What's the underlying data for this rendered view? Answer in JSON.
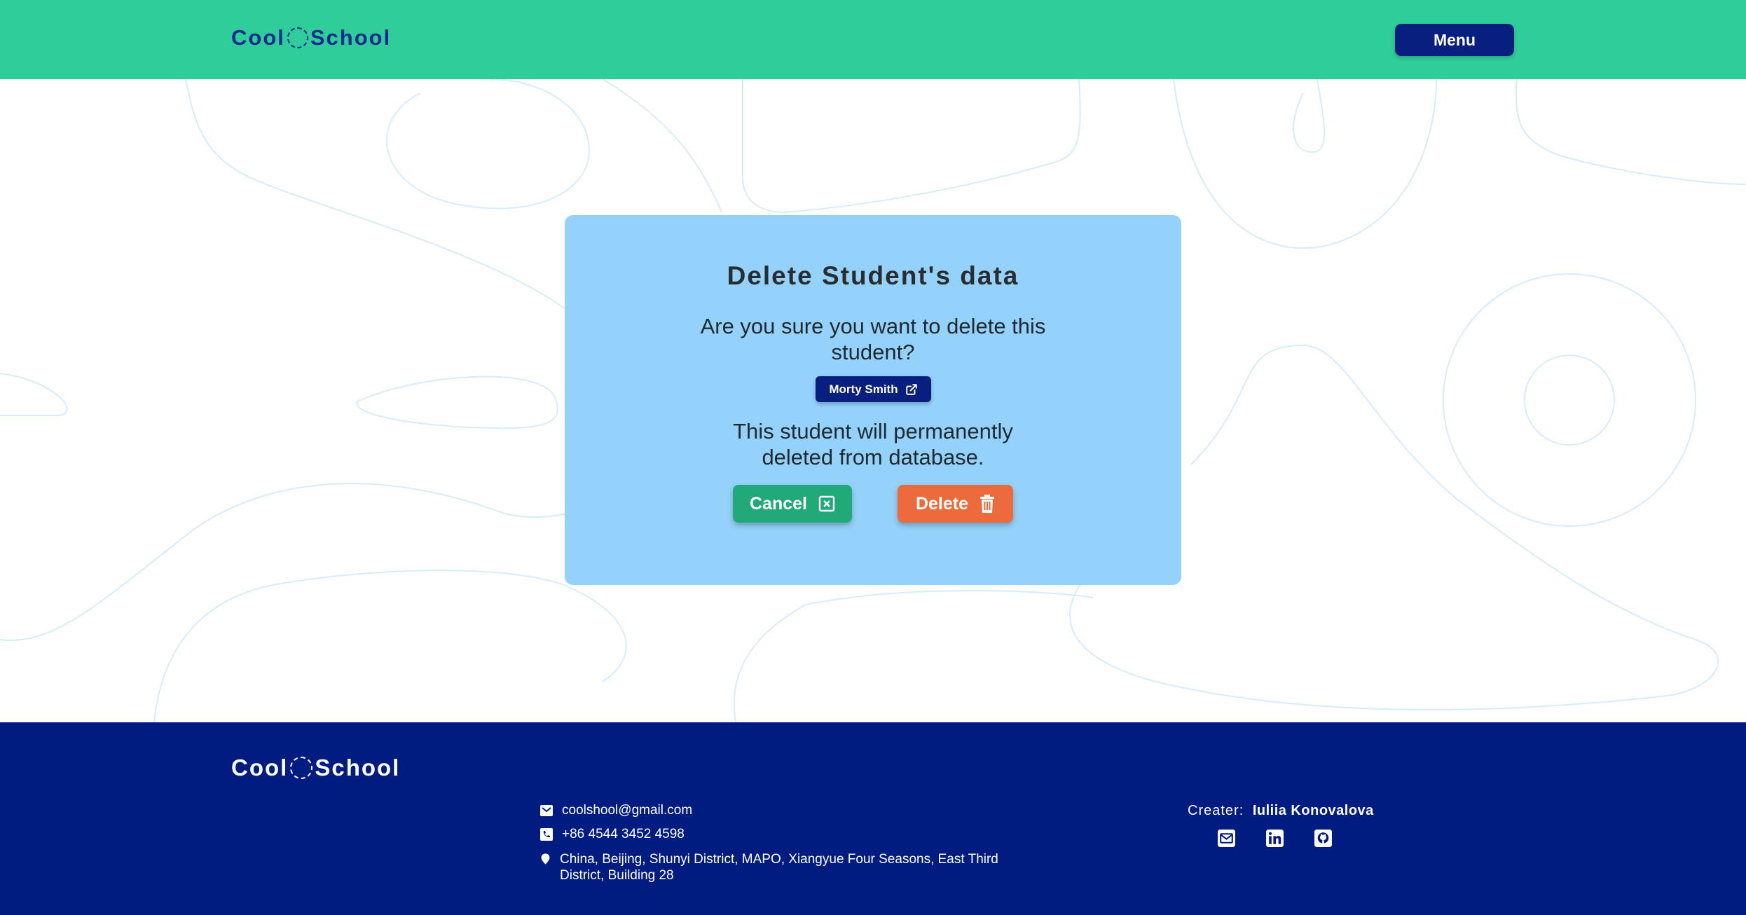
{
  "header": {
    "logo_left": "Cool",
    "logo_right": "School",
    "menu_label": "Menu"
  },
  "modal": {
    "title": "Delete Student's data",
    "question": "Are you sure you want to delete this student?",
    "student_name": "Morty Smith",
    "warning": "This student will permanently deleted from database.",
    "cancel_label": "Cancel",
    "delete_label": "Delete"
  },
  "footer": {
    "logo_left": "Cool",
    "logo_right": "School",
    "email": "coolshool@gmail.com",
    "phone": "+86 4544 3452 4598",
    "address": "China, Beijing, Shunyi District, MAPO, Xiangyue Four Seasons, East Third District, Building 28",
    "creator_label": "Creater:",
    "creator_name": "Iuliia Konovalova"
  },
  "icons": {
    "globe": "globe-icon",
    "external_link": "external-link-icon",
    "cancel": "close-box-icon",
    "delete": "trash-icon",
    "email": "envelope-icon",
    "phone": "phone-icon",
    "location": "map-pin-icon",
    "socials": [
      "envelope-icon",
      "linkedin-icon",
      "github-icon"
    ]
  },
  "colors": {
    "header_bg": "#2fcd9a",
    "brand_navy": "#081f7f",
    "modal_bg": "#94d2fb",
    "cancel": "#21a97a",
    "delete": "#ed6a3c",
    "footer_bg": "#011c80"
  }
}
